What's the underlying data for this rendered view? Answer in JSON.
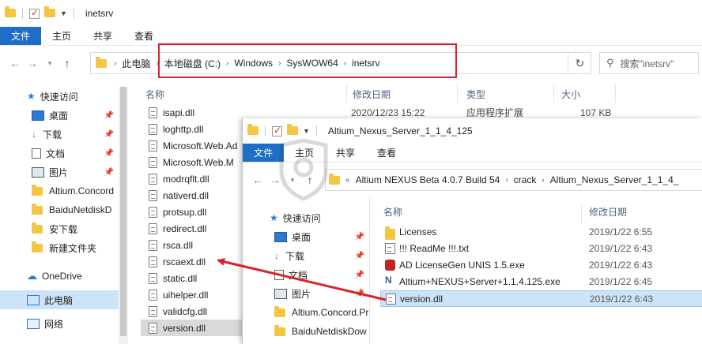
{
  "back": {
    "title": "inetsrv",
    "ribbon_tabs": [
      "文件",
      "主页",
      "共享",
      "查看"
    ],
    "breadcrumb": [
      "此电脑",
      "本地磁盘 (C:)",
      "Windows",
      "SysWOW64",
      "inetsrv"
    ],
    "search_placeholder": "搜索\"inetsrv\"",
    "sidebar": [
      {
        "label": "快速访问",
        "icon": "star-icon"
      },
      {
        "label": "桌面",
        "icon": "desktop-icon"
      },
      {
        "label": "下载",
        "icon": "download-arrow-icon"
      },
      {
        "label": "文档",
        "icon": "document-icon"
      },
      {
        "label": "图片",
        "icon": "picture-icon"
      },
      {
        "label": "Altium.Concord",
        "icon": "folder-icon"
      },
      {
        "label": "BaiduNetdiskD",
        "icon": "folder-icon"
      },
      {
        "label": "安下载",
        "icon": "folder-icon"
      },
      {
        "label": "新建文件夹",
        "icon": "folder-icon"
      },
      {
        "label": "OneDrive",
        "icon": "cloud-icon"
      },
      {
        "label": "此电脑",
        "icon": "computer-icon"
      },
      {
        "label": "网络",
        "icon": "network-icon"
      }
    ],
    "columns": {
      "name": "名称",
      "date": "修改日期",
      "type": "类型",
      "size": "大小"
    },
    "first_file": {
      "date": "2020/12/23 15:22",
      "type": "应用程序扩展",
      "size": "107 KB"
    },
    "files": [
      "isapi.dll",
      "loghttp.dll",
      "Microsoft.Web.Ad",
      "Microsoft.Web.M",
      "modrqflt.dll",
      "nativerd.dll",
      "protsup.dll",
      "redirect.dll",
      "rsca.dll",
      "rscaext.dll",
      "static.dll",
      "uihelper.dll",
      "validcfg.dll",
      "version.dll"
    ]
  },
  "front": {
    "title": "Altium_Nexus_Server_1_1_4_125",
    "ribbon_tabs": [
      "文件",
      "主页",
      "共享",
      "查看"
    ],
    "breadcrumb": [
      "Altium NEXUS Beta 4.0.7 Build 54",
      "crack",
      "Altium_Nexus_Server_1_1_4_"
    ],
    "sidebar": [
      {
        "label": "快速访问",
        "icon": "star-icon"
      },
      {
        "label": "桌面",
        "icon": "desktop-icon"
      },
      {
        "label": "下载",
        "icon": "download-arrow-icon"
      },
      {
        "label": "文档",
        "icon": "document-icon"
      },
      {
        "label": "图片",
        "icon": "picture-icon"
      },
      {
        "label": "Altium.Concord.Pr",
        "icon": "folder-icon"
      },
      {
        "label": "BaiduNetdiskDow",
        "icon": "folder-icon"
      }
    ],
    "columns": {
      "name": "名称",
      "date": "修改日期"
    },
    "files": [
      {
        "name": "Licenses",
        "date": "2019/1/22 6:55",
        "icon": "folder-icon"
      },
      {
        "name": "!!! ReadMe !!!.txt",
        "date": "2019/1/22 6:43",
        "icon": "text-file-icon"
      },
      {
        "name": "AD LicenseGen UNIS 1.5.exe",
        "date": "2019/1/22 6:43",
        "icon": "app-red-icon"
      },
      {
        "name": "Altium+NEXUS+Server+1.1.4.125.exe",
        "date": "2019/1/22 6:45",
        "icon": "altium-exe-icon"
      },
      {
        "name": "version.dll",
        "date": "2019/1/22 6:43",
        "icon": "dll-file-icon"
      }
    ]
  },
  "colors": {
    "accent": "#1e6ec8",
    "highlight_box": "#d9232d",
    "arrow": "#d9232d",
    "selection": "#cce4f7"
  }
}
